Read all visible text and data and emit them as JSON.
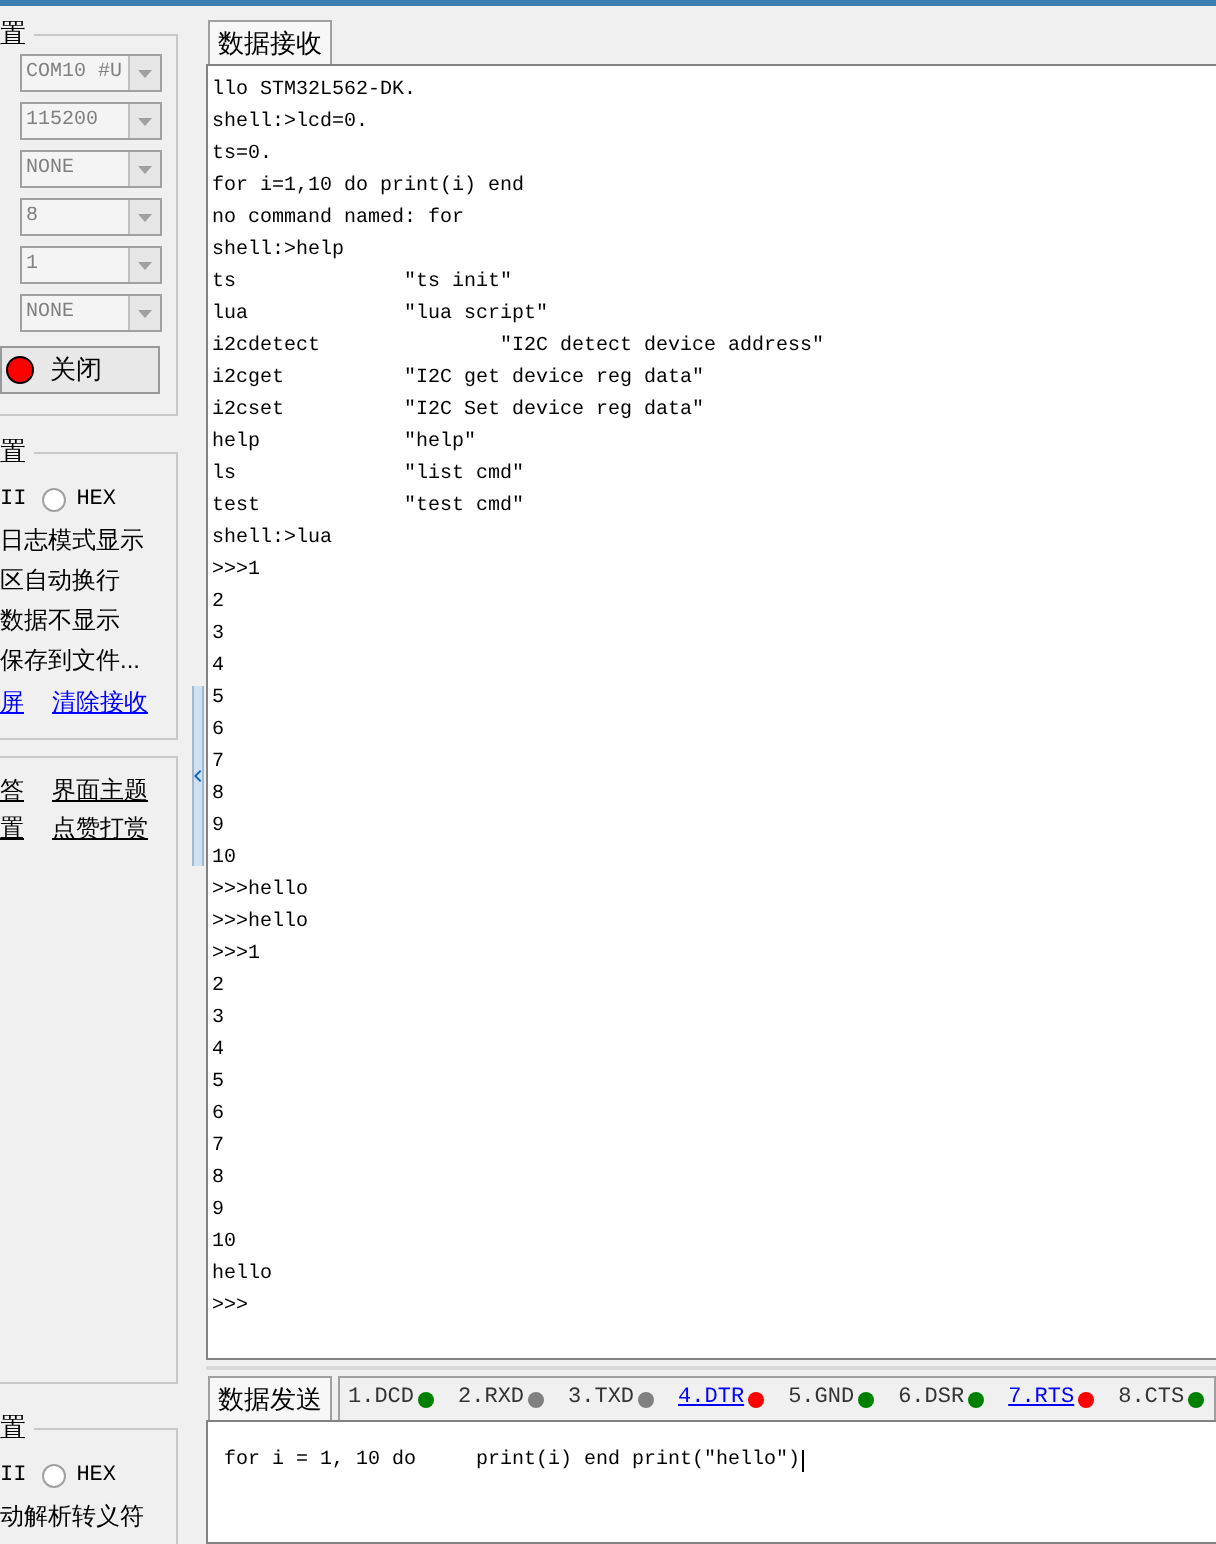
{
  "serial_settings": {
    "title": "置",
    "combos": [
      {
        "value": "COM10 #U",
        "disabled": true
      },
      {
        "value": "115200",
        "disabled": true
      },
      {
        "value": "NONE",
        "disabled": true
      },
      {
        "value": "8",
        "disabled": true
      },
      {
        "value": "1",
        "disabled": true
      },
      {
        "value": "NONE",
        "disabled": true
      }
    ],
    "open_button": {
      "label": "关闭",
      "on": true
    }
  },
  "receive_settings": {
    "title": "置",
    "radios": [
      {
        "label": "II"
      },
      {
        "label": "HEX",
        "selected": false
      }
    ],
    "options": [
      "日志模式显示",
      "区自动换行",
      "数据不显示",
      "保存到文件..."
    ],
    "links": [
      "屏",
      "清除接收"
    ]
  },
  "extras": {
    "rows": [
      [
        "答",
        "界面主题"
      ],
      [
        "置",
        "点赞打赏"
      ]
    ]
  },
  "send_settings": {
    "title": "置",
    "radios": [
      {
        "label": "II"
      },
      {
        "label": "HEX",
        "selected": false
      }
    ],
    "options": [
      "动解析转义符"
    ]
  },
  "receive_tab": {
    "label": "数据接收",
    "selected": true
  },
  "receive_lines": [
    "llo STM32L562-DK.",
    "shell:>lcd=0.",
    "ts=0.",
    "for i=1,10 do print(i) end",
    "no command named: for",
    "shell:>help",
    "ts              \"ts init\"",
    "lua             \"lua script\"",
    "i2cdetect               \"I2C detect device address\"",
    "i2cget          \"I2C get device reg data\"",
    "i2cset          \"I2C Set device reg data\"",
    "help            \"help\"",
    "ls              \"list cmd\"",
    "test            \"test cmd\"",
    "shell:>lua",
    ">>>1",
    "2",
    "3",
    "4",
    "5",
    "6",
    "7",
    "8",
    "9",
    "10",
    ">>>hello",
    ">>>hello",
    ">>>1",
    "2",
    "3",
    "4",
    "5",
    "6",
    "7",
    "8",
    "9",
    "10",
    "hello",
    ">>>"
  ],
  "send_tab": {
    "label": "数据发送",
    "selected": true
  },
  "signals": [
    {
      "label": "1.DCD",
      "color": "#008000",
      "link": false
    },
    {
      "label": "2.RXD",
      "color": "#808080",
      "link": false
    },
    {
      "label": "3.TXD",
      "color": "#808080",
      "link": false
    },
    {
      "label": "4.DTR",
      "color": "#ff0000",
      "link": true
    },
    {
      "label": "5.GND",
      "color": "#008000",
      "link": false
    },
    {
      "label": "6.DSR",
      "color": "#008000",
      "link": false
    },
    {
      "label": "7.RTS",
      "color": "#ff0000",
      "link": true
    },
    {
      "label": "8.CTS",
      "color": "#008000",
      "link": false
    }
  ],
  "send_text": "for i = 1, 10 do     print(i) end print(\"hello\")"
}
